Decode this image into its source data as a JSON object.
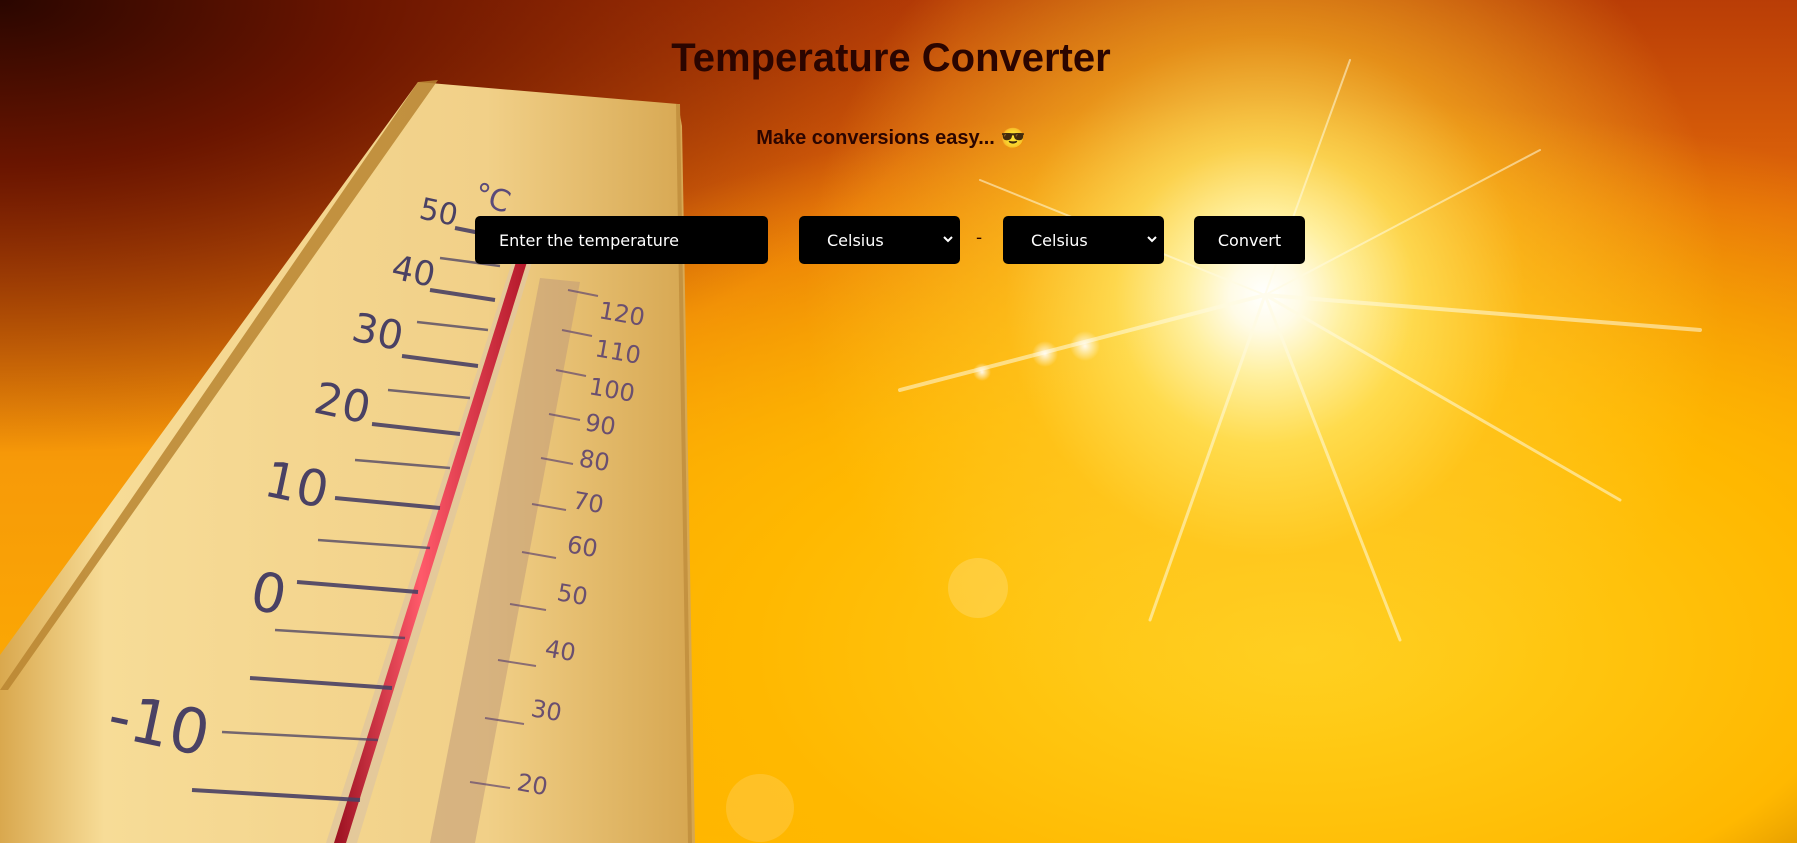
{
  "page": {
    "title": "Temperature Converter",
    "tagline": "Make conversions easy...",
    "tagline_emoji": "😎"
  },
  "converter": {
    "input_placeholder": "Enter the temperature",
    "input_value": "",
    "from_unit": "Celsius",
    "separator": "-",
    "to_unit": "Celsius",
    "convert_label": "Convert"
  },
  "background": {
    "thermometer_celsius_unit": "°C",
    "celsius_scale": [
      "50",
      "40",
      "30",
      "20",
      "10",
      "0",
      "-10"
    ],
    "fahrenheit_scale": [
      "120",
      "110",
      "100",
      "90",
      "80",
      "70",
      "60",
      "50",
      "40",
      "30",
      "20"
    ]
  },
  "colors": {
    "controls_bg": "#000000",
    "controls_text": "#ffffff",
    "heading_text": "#2b0500",
    "mercury": "#d8263a"
  }
}
